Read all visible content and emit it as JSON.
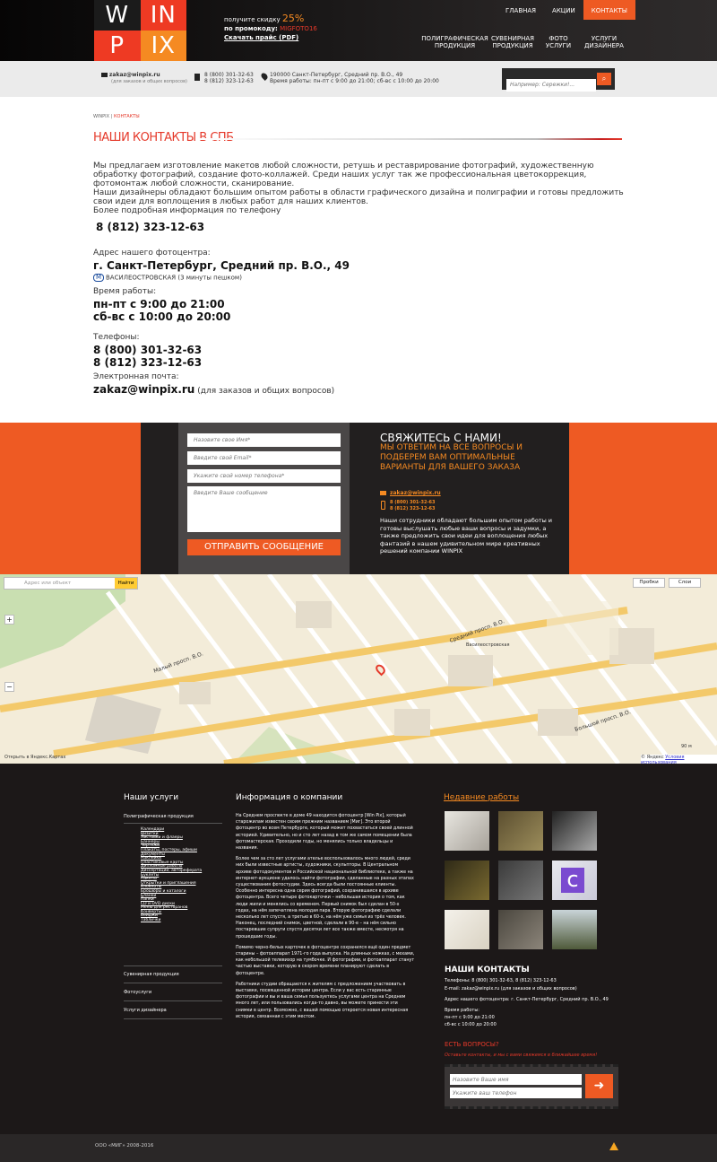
{
  "header": {
    "logo": [
      "W",
      "IN",
      "P",
      "IX"
    ],
    "promo": {
      "line1": "получите скидку",
      "percent": "25%",
      "line2": "по промокоду:",
      "code": "MIGFOTO16",
      "link": "Скачать прайс (PDF)"
    },
    "nav_top": [
      "ГЛАВНАЯ",
      "АКЦИИ",
      "КОНТАКТЫ"
    ],
    "nav_bottom": [
      "ПОЛИГРАФИЧЕСКАЯ ПРОДУКЦИЯ",
      "СУВЕНИРНАЯ ПРОДУКЦИЯ",
      "ФОТО УСЛУГИ",
      "УСЛУГИ ДИЗАЙНЕРА"
    ]
  },
  "infobar": {
    "email": "zakaz@winpix.ru",
    "email_note": "(для заказов и общих вопросов)",
    "phone1": "8 (800) 301-32-63",
    "phone2": "8 (812) 323-12-63",
    "address": "190000 Санкт-Петербург, Средний пр. В.О., 49",
    "hours": "Время работы: пн-пт с 9:00 до 21:00; сб-вс с 10:00 до 20:00",
    "search_placeholder": "Например: Сережки!..."
  },
  "breadcrumb": {
    "home": "WINPIX",
    "current": "КОНТАКТЫ"
  },
  "title": "НАШИ КОНТАКТЫ В СПБ",
  "content": {
    "p1": "Мы предлагаем изготовление макетов любой сложности, ретушь и реставрирование фотографий, художественную обработку фотографий, создание фото-коллажей. Среди наших услуг так же профессиональная цветокоррекция, фотомонтаж любой сложности, сканирование.",
    "p2": "Наши дизайнеры обладают большим опытом работы в области графического дизайна и полиграфии и готовы предложить свои идеи для воплощения в любых работ для наших клиентов.",
    "more": "Более подробная информация по телефону",
    "phone_main": "8 (812) 323-12-63",
    "addr_label": "Адрес нашего фотоцентра:",
    "addr": "г. Санкт-Петербург, Средний пр. В.О., 49",
    "metro": "ВАСИЛЕОСТРОВСКАЯ (3 минуты пешком)",
    "hours_label": "Время работы:",
    "hours1": "пн-пт  с 9:00 до 21:00",
    "hours2": "сб-вс  с 10:00 до 20:00",
    "phones_label": "Телефоны:",
    "ph1": "8 (800) 301-32-63",
    "ph2": "8 (812) 323-12-63",
    "email_label": "Электронная почта:",
    "email": "zakaz@winpix.ru",
    "email_note": "(для заказов и общих вопросов)"
  },
  "form": {
    "name_ph": "Назовите свое Имя*",
    "email_ph": "Введите свой Email*",
    "phone_ph": "Укажите свой номер телефона*",
    "msg_ph": "Введите Ваше сообщение",
    "submit": "ОТПРАВИТЬ СООБЩЕНИЕ",
    "title": "СВЯЖИТЕСЬ С НАМИ!",
    "subtitle": "МЫ ОТВЕТИМ НА ВСЕ ВОПРОСЫ И ПОДБЕРЕМ ВАМ ОПТИМАЛЬНЫЕ ВАРИАНТЫ ДЛЯ ВАШЕГО ЗАКАЗА",
    "email": "zakaz@winpix.ru",
    "ph1": "8 (800) 301-32-63",
    "ph2": "8 (812) 323-12-63",
    "desc": "Наши сотрудники обладают большим опытом работы и готовы выслушать любые ваши вопросы и задумки, а также предложить свои идеи для воплощения любых фантазий в нашем удивительном мире креативных решений компании WINPIX"
  },
  "map": {
    "search_ph": "Адрес или объект",
    "find": "Найти",
    "probki": "Пробки",
    "layers": "Слои",
    "streets": [
      "Средний просп. В.О.",
      "Малый просп. В.О.",
      "Большой просп. В.О.",
      "Средний просп. В.О.",
      "Большой просп. В.О."
    ],
    "poi": "Василеостровская",
    "open": "Открыть в Яндекс.Картах",
    "scale": "90 м",
    "yandex": "© Яндекс",
    "terms": "Условия использования"
  },
  "footer": {
    "svc_title": "Наши услуги",
    "svc1": "Полиграфическая продукция",
    "svc_sub": [
      "Календари",
      "Визитки",
      "Листовки и флаеры",
      "Баннеры",
      "Чертежи",
      "Плакаты, постеры, афиши",
      "Документы",
      "Наклейки",
      "Пластиковые карты",
      "Дипломные работы",
      "Диссертации, автореферата",
      "Буклеты",
      "Пакеты",
      "Открытки и приглашения",
      "Блокноты",
      "Брошюры и каталоги",
      "Бланки",
      "Папки",
      "CD и DVD диски",
      "Меню для ресторанов",
      "Конверты",
      "Бейджи",
      "Таблички"
    ],
    "svc2": "Сувенирная продукция",
    "svc3": "Фотоуслуги",
    "svc4": "Услуги дизайнера",
    "info_title": "Информация о компании",
    "info_p1": "На Среднем проспекте в доме 49 находится фотоцентр [Win Pix], который старожилам известен своим прежним названием [Миг]. Это второй фотоцентр во всем Петербурге, который может похвастаться своей длинной историей. Удивительно, но и сто лет назад в том же самом помещении была фотомастерская. Проходили годы, но менялись только владельцы и названия.",
    "info_p2": "Более чем за сто лет услугами ателье воспользовалось много людей, среди них были известные артисты, художники, скульпторы. В Центральном архиве фотодокументов и Российской национальной библиотеке, а также на интернет-аукционе удалось найти фотографии, сделанные на разных этапах существования фотостудии. Здесь всегда были постоянные клиенты. Особенно интересна одна серия фотографий, сохранившаяся в архиве фотоцентра. Всего четыре фотокарточки – небольшая история о том, как люди жили и менялись со временем. Первый снимок был сделан в 50-х годах, на нём запечатлена молодая пара. Вторую фотографию сделали несколько лет спустя, а третью в 60-х, на нём уже семья из трёх человек. Наконец, последний снимок, цветной, сделали в 90-е – на нём сильно постаревшие супруги спустя десятки лет все также вместе, несмотря на прошедшие годы.",
    "info_p3": "Помимо черно-белых карточек в фотоцентре сохранился ещё один предмет старины – фотоаппарат 1971-го года выпуска. На длинных ножках, с мехами, как небольшой телевизор на тумбочке. И фотографии, и фотоаппарат станут частью выставки, которую в скором времени планируют сделать в фотоцентре.",
    "info_p4": "Работники студии обращаются к жителям с предложением участвовать в выставке, посвященной истории центра. Если у вас есть старинные фотографии и вы и ваша семья пользуетесь услугами центра на Среднем много лет, или пользовались когда-то давно, вы можете принести эти снимки в центр. Возможно, с вашей помощью откроется новая интересная история, связанная с этим местом.",
    "recent_title": "Недавние работы",
    "contacts_title": "НАШИ КОНТАКТЫ",
    "c_phones": "Телефоны: 8 (800) 301-32-63, 8 (812) 323-12-63",
    "c_email": "E-mail: zakaz@winpix.ru (для заказов и общих вопросов)",
    "c_addr": "Адрес нашего фотоцентра: г. Санкт-Петербург, Средний пр. В.О., 49",
    "c_hours_label": "Время работы:",
    "c_h1": "пн-пт с 9:00 до 21:00",
    "c_h2": "сб-вс с 10:00 до 20:00",
    "q_title": "ЕСТЬ ВОПРОСЫ?",
    "q_sub": "Оставьте контакты, и мы с вами свяжемся в ближайшее время!",
    "q_name_ph": "Назовите Ваше имя",
    "q_phone_ph": "Укажите ваш телефон",
    "copyright": "ООО «МИГ» 2008-2016"
  },
  "colors": {
    "accent": "#ee5a23",
    "red": "#e5392a",
    "orange": "#f58a22",
    "dark": "#1c1818"
  }
}
